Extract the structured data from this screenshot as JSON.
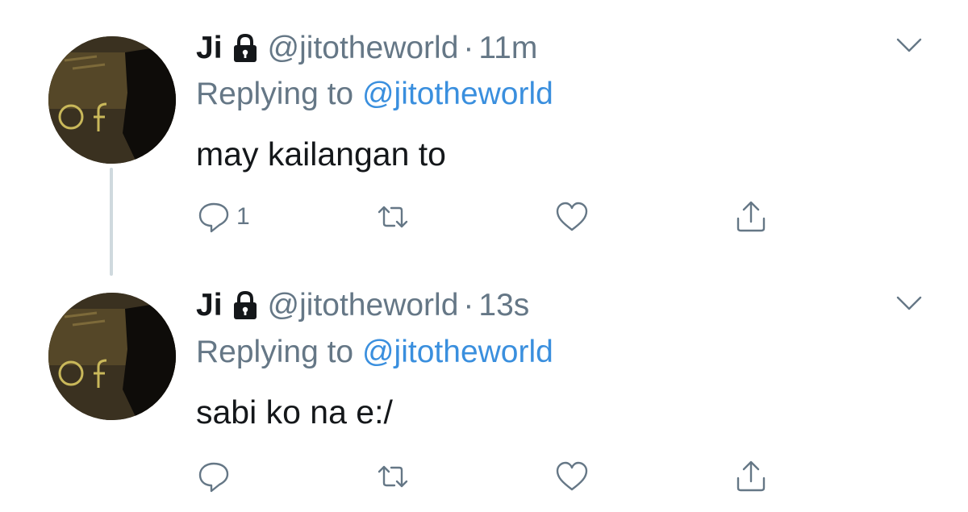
{
  "tweets": [
    {
      "name": "Ji",
      "handle": "@jitotheworld",
      "separator": "·",
      "time": "11m",
      "replying_prefix": "Replying to",
      "replying_handle": "@jitotheworld",
      "text": "may kailangan to",
      "reply_count": "1",
      "icons": [
        "lock-icon",
        "chevron-down-icon",
        "reply-icon",
        "retweet-icon",
        "heart-icon",
        "share-icon"
      ]
    },
    {
      "name": "Ji",
      "handle": "@jitotheworld",
      "separator": "·",
      "time": "13s",
      "replying_prefix": "Replying to",
      "replying_handle": "@jitotheworld",
      "text": "sabi ko na e:/",
      "reply_count": "",
      "icons": [
        "lock-icon",
        "chevron-down-icon",
        "reply-icon",
        "retweet-icon",
        "heart-icon",
        "share-icon"
      ]
    }
  ],
  "colors": {
    "name": "#14171a",
    "secondary": "#657786",
    "link": "#3a8fde",
    "thread_line": "#cfd9de",
    "background": "#ffffff"
  }
}
